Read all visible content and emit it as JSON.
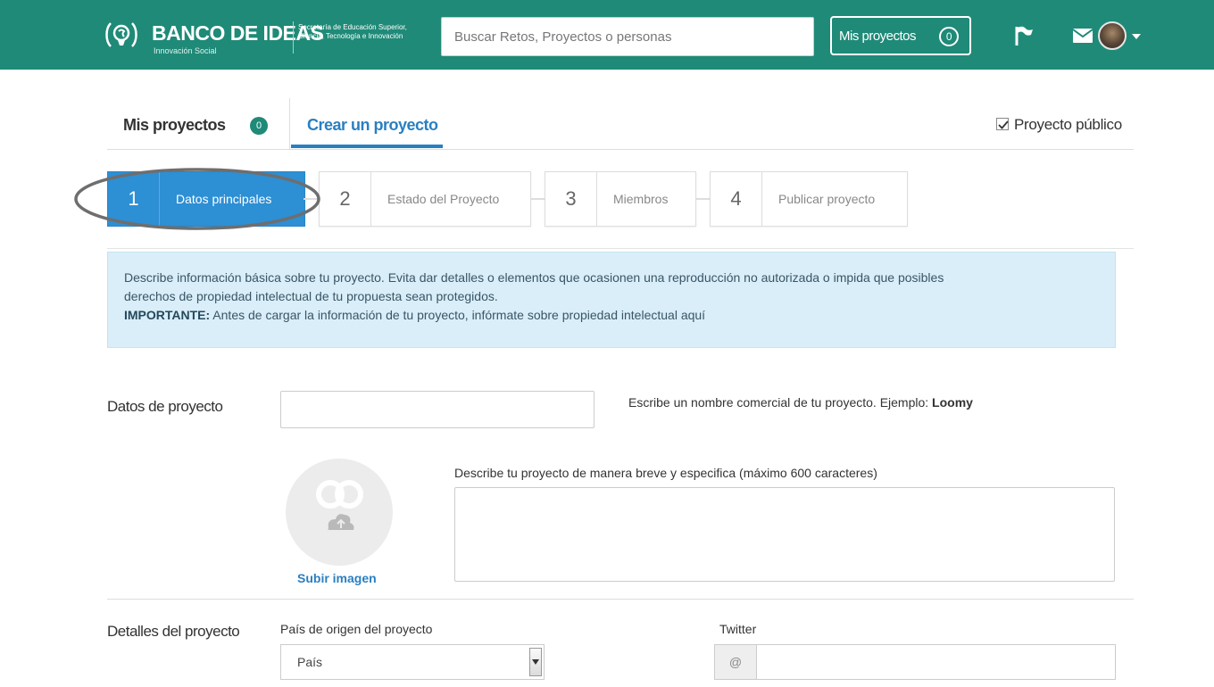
{
  "header": {
    "brand": "BANCO DE IDEAS",
    "brand_sub": "Innovación Social",
    "secretaria": "Secretaría de Educación Superior, Ciencia, Tecnología e Innovación",
    "search_placeholder": "Buscar Retos, Proyectos o personas",
    "my_projects_label": "Mis proyectos",
    "my_projects_count": "0",
    "bg_color": "#1f8a78"
  },
  "tabs": {
    "mine_label": "Mis proyectos",
    "mine_count": "0",
    "create_label": "Crear un proyecto",
    "public_label": "Proyecto público",
    "public_checked": true
  },
  "steps": [
    {
      "num": "1",
      "label": "Datos principales",
      "active": true
    },
    {
      "num": "2",
      "label": "Estado del Proyecto",
      "active": false
    },
    {
      "num": "3",
      "label": "Miembros",
      "active": false
    },
    {
      "num": "4",
      "label": "Publicar proyecto",
      "active": false
    }
  ],
  "info": {
    "line1": "Describe información básica sobre tu proyecto. Evita dar detalles o elementos que ocasionen una reproducción no autorizada o impida que posibles",
    "line2": "derechos de propiedad intelectual de tu propuesta sean protegidos.",
    "important_label": "IMPORTANTE:",
    "important_text": " Antes de cargar la información de tu proyecto, infórmate sobre propiedad intelectual aquí"
  },
  "form": {
    "section_data": "Datos de proyecto",
    "name_hint": "Escribe un nombre comercial de tu proyecto. Ejemplo: ",
    "name_hint_example": "Loomy",
    "desc_hint": "Describe tu proyecto de manera breve y especifica (máximo 600 caracteres)",
    "upload_label": "Subir imagen",
    "section_details": "Detalles del proyecto",
    "country_label": "País de origen del proyecto",
    "country_value": "País",
    "twitter_label": "Twitter",
    "twitter_prefix": "@"
  }
}
